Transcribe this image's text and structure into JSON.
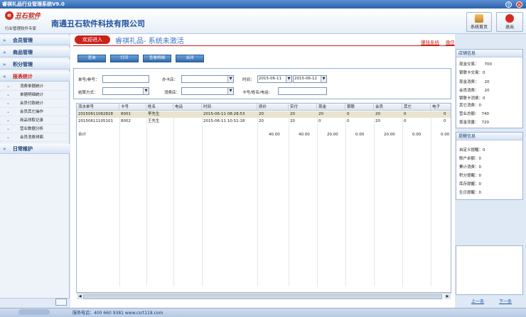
{
  "app_title": "睿祺礼品行业管理系统V9.0",
  "logo": {
    "brand": "丑石软件",
    "sub": "High-End Software",
    "tagline": "行业管理软件专家"
  },
  "company": "南通丑石软件科技有限公司",
  "header_buttons": [
    {
      "label": "系统首页",
      "icon": "home-icon"
    },
    {
      "label": "退出",
      "icon": "power-icon"
    }
  ],
  "sidebar": {
    "sections": [
      {
        "label": "会员管理"
      },
      {
        "label": "商品管理"
      },
      {
        "label": "积分管理"
      },
      {
        "label": "报表统计"
      },
      {
        "label": "日常维护"
      }
    ],
    "report_items": [
      "消费单据统计",
      "单据明细统计",
      "会员付款统计",
      "会员其它操作",
      "商品领取记录",
      "营业数据分析",
      "会员消费排面"
    ]
  },
  "welcome": {
    "button": "欢迎进入",
    "text": "睿祺礼品- 系统未激活"
  },
  "top_links": [
    "赚钱系统",
    "微信扩展平台"
  ],
  "toolbar": [
    "查询",
    "打印",
    "查看明细",
    "关闭"
  ],
  "filter": {
    "order_label": "单号/券号：",
    "order_value": "",
    "store_label": "办卡店：",
    "store_value": "",
    "time_label": "时间：",
    "date_from": "2015-06-11",
    "date_to": "2015-06-12",
    "pay_label": "结算方式：",
    "pay_value": "",
    "consume_store_label": "消费店：",
    "consume_store_value": "",
    "card_label": "卡号/姓名/电话：",
    "card_value": ""
  },
  "table": {
    "columns": [
      "流水单号",
      "卡号",
      "姓名",
      "电话",
      "时间",
      "原价",
      "实付",
      "现金",
      "银联",
      "会员",
      "其它",
      "电子"
    ],
    "rows": [
      [
        "20150611082828",
        "8001",
        "李先生",
        "",
        "2015-06-11 08:28:53",
        "20",
        "20",
        "20",
        "0",
        "20",
        "0",
        "0"
      ],
      [
        "20150611105101",
        "8002",
        "王先生",
        "",
        "2015-06-11 10:51:18",
        "20",
        "20",
        "0",
        "0",
        "20",
        "0",
        "0"
      ]
    ],
    "total": [
      "合计",
      "",
      "",
      "",
      "",
      "40.00",
      "40.00",
      "20.00",
      "0.00",
      "20.00",
      "0.00",
      "0.00"
    ]
  },
  "store_info": {
    "title": "店铺信息",
    "rows": [
      {
        "label": "现金交易：",
        "value": "700"
      },
      {
        "label": "银联卡交易：",
        "value": "0"
      },
      {
        "label": "现金消费：",
        "value": "20"
      },
      {
        "label": "会员消费：",
        "value": "20"
      },
      {
        "label": "银联卡消费：",
        "value": "0"
      },
      {
        "label": "其它消费：",
        "value": "0"
      },
      {
        "label": "营业总额：",
        "value": "740"
      },
      {
        "label": "现金流量：",
        "value": "720"
      }
    ]
  },
  "reminder": {
    "title": "提醒信息",
    "rows": [
      {
        "label": "自定义提醒：",
        "value": "0"
      },
      {
        "label": "账户余额：",
        "value": "0"
      },
      {
        "label": "累计消费：",
        "value": "0"
      },
      {
        "label": "积分提醒：",
        "value": "0"
      },
      {
        "label": "库存提醒：",
        "value": "0"
      },
      {
        "label": "生日提醒：",
        "value": "0"
      }
    ]
  },
  "pager": {
    "prev": "上一条",
    "next": "下一条"
  },
  "status": "服务电话：400 660 9381 www.csrt118.com"
}
